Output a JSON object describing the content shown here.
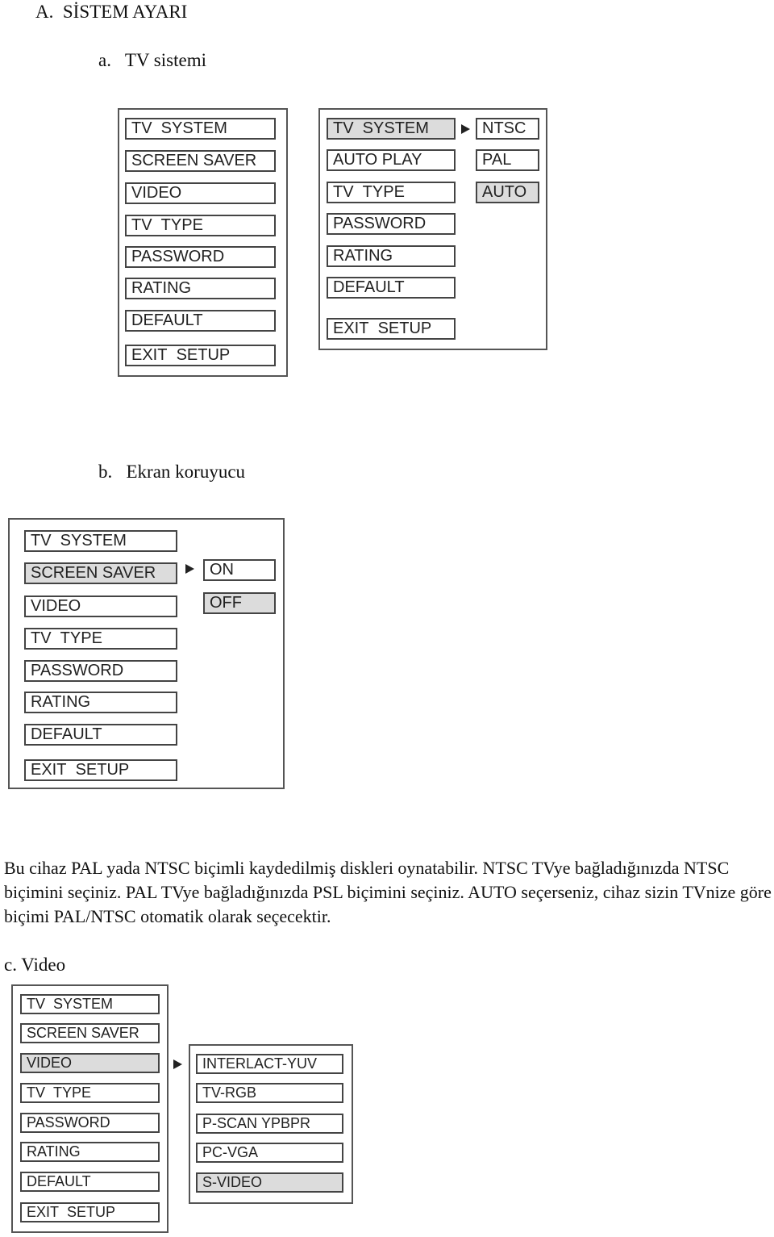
{
  "section": {
    "letter": "A.",
    "title": "SİSTEM AYARI"
  },
  "subsections": {
    "a": {
      "letter": "a.",
      "title": "TV sistemi"
    },
    "b": {
      "letter": "b.",
      "title": "Ekran koruyucu"
    },
    "c": {
      "title": "c. Video"
    }
  },
  "fig_a_main": {
    "items": [
      "TV  SYSTEM",
      "SCREEN SAVER",
      "VIDEO",
      "TV  TYPE",
      "PASSWORD",
      "RATING",
      "DEFAULT",
      "EXIT  SETUP"
    ]
  },
  "fig_a_sub": {
    "items": [
      "TV  SYSTEM",
      "AUTO PLAY",
      "TV  TYPE",
      "PASSWORD",
      "RATING",
      "DEFAULT",
      "EXIT  SETUP"
    ],
    "selected": "TV  SYSTEM",
    "options": [
      "NTSC",
      "PAL",
      "AUTO"
    ],
    "selected_option": "AUTO"
  },
  "fig_b": {
    "items": [
      "TV  SYSTEM",
      "SCREEN SAVER",
      "VIDEO",
      "TV  TYPE",
      "PASSWORD",
      "RATING",
      "DEFAULT",
      "EXIT  SETUP"
    ],
    "selected": "SCREEN SAVER",
    "options": [
      "ON",
      "OFF"
    ],
    "selected_option": "OFF"
  },
  "paragraph": "Bu cihaz PAL yada NTSC biçimli kaydedilmiş diskleri oynatabilir. NTSC TVye bağladığınızda NTSC biçimini seçiniz. PAL TVye bağladığınızda PSL biçimini seçiniz. AUTO seçerseniz, cihaz sizin TVnize göre biçimi PAL/NTSC otomatik olarak seçecektir.",
  "fig_c": {
    "items": [
      "TV  SYSTEM",
      "SCREEN SAVER",
      "VIDEO",
      "TV  TYPE",
      "PASSWORD",
      "RATING",
      "DEFAULT",
      "EXIT  SETUP"
    ],
    "selected": "VIDEO",
    "options": [
      "INTERLACT-YUV",
      "TV-RGB",
      "P-SCAN YPBPR",
      "PC-VGA",
      "S-VIDEO"
    ],
    "selected_option": "S-VIDEO"
  },
  "colors": {
    "highlight": "#dcdcdc",
    "border": "#444444"
  }
}
